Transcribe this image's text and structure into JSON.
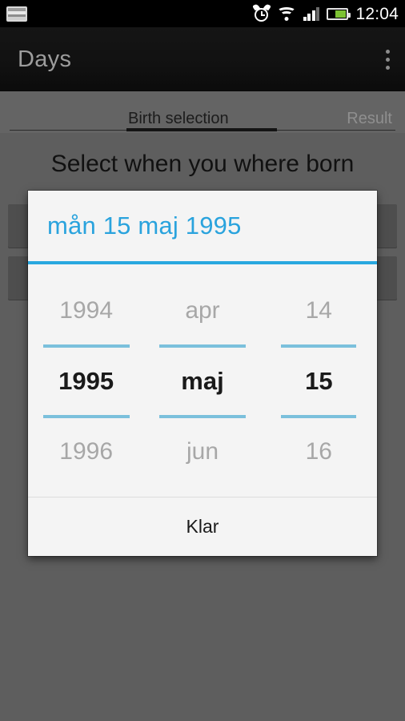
{
  "statusbar": {
    "notification_icon": "screenshot-icon",
    "icons": [
      "alarm-icon",
      "wifi-icon",
      "signal-icon",
      "battery-icon"
    ],
    "time": "12:04",
    "battery_level_percent": 58
  },
  "actionbar": {
    "title": "Days",
    "overflow_label": "overflow-menu"
  },
  "tabs": {
    "items": [
      {
        "label": "Birth selection",
        "selected": true
      },
      {
        "label": "Result",
        "selected": false
      }
    ]
  },
  "content": {
    "headline": "Select when you where born"
  },
  "dialog": {
    "header": "mån 15 maj 1995",
    "accent_color": "#29a8df",
    "divider_color": "#7bc0dc",
    "columns": {
      "year": {
        "prev": "1994",
        "selected": "1995",
        "next": "1996"
      },
      "month": {
        "prev": "apr",
        "selected": "maj",
        "next": "jun"
      },
      "day": {
        "prev": "14",
        "selected": "15",
        "next": "16"
      }
    },
    "confirm_label": "Klar"
  }
}
